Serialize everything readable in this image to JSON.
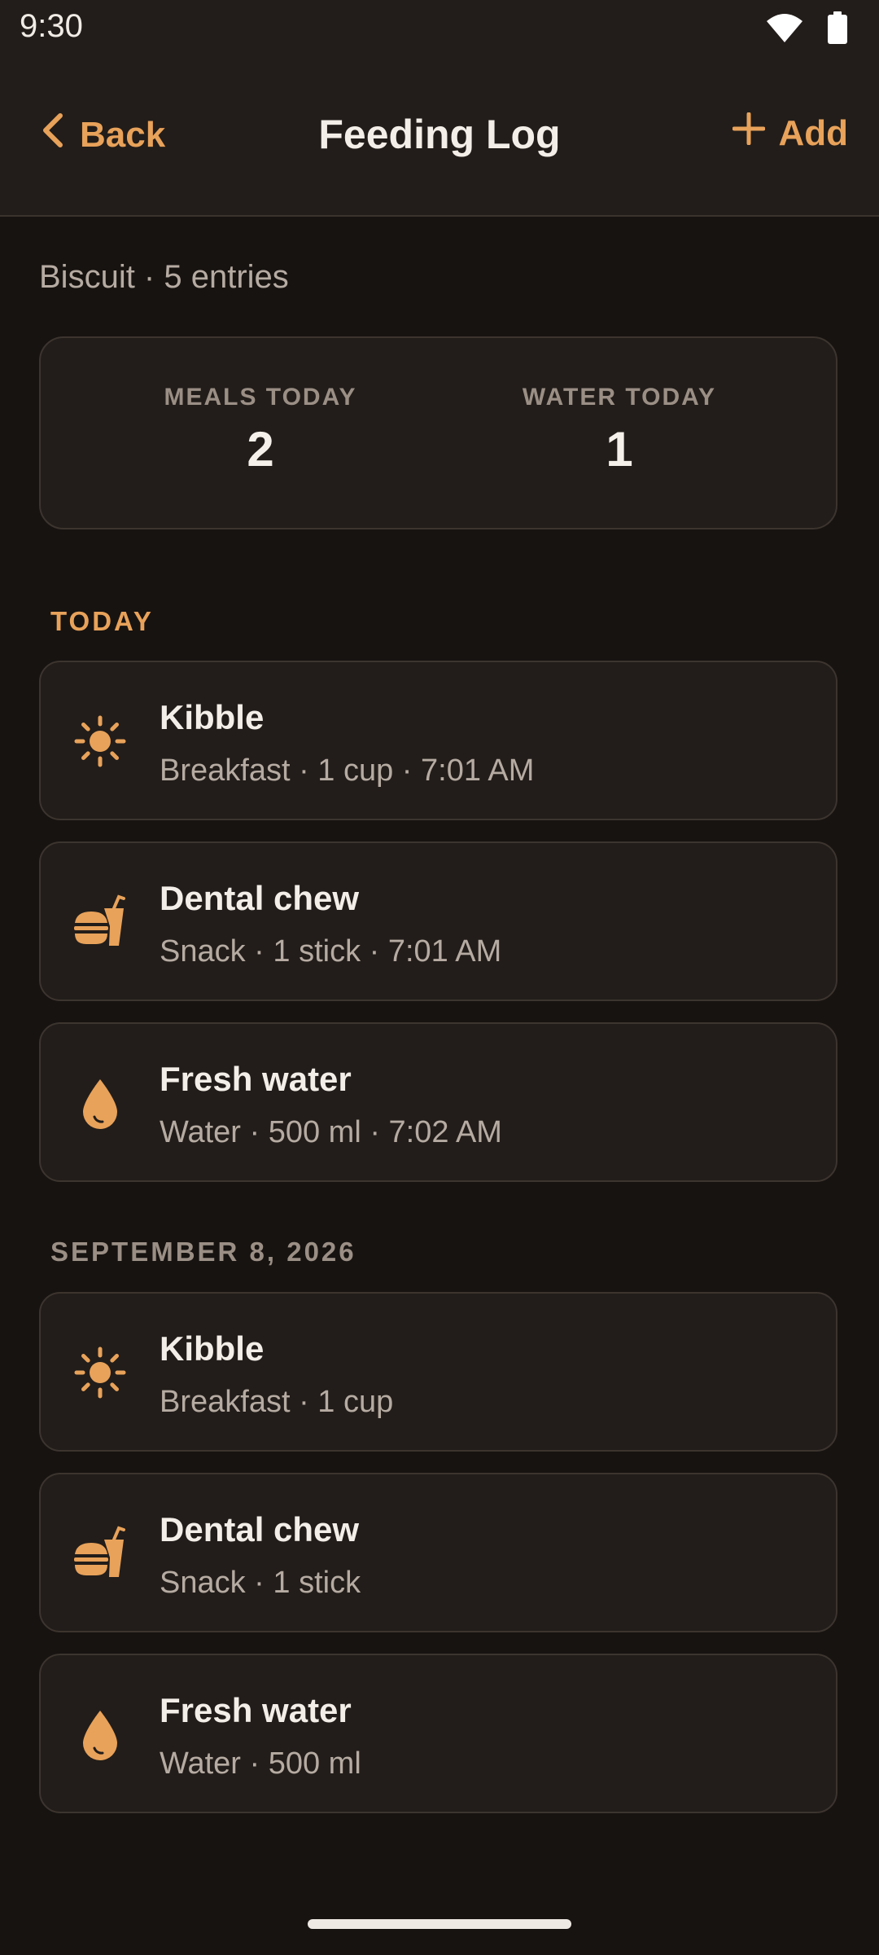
{
  "status_bar": {
    "time": "9:30",
    "wifi_icon": "wifi-icon",
    "battery_icon": "battery-icon"
  },
  "header": {
    "back_label": "Back",
    "title": "Feeding Log",
    "add_label": "Add"
  },
  "subtitle": "Biscuit · 5 entries",
  "stats": {
    "meals_label": "MEALS TODAY",
    "meals_value": "2",
    "water_label": "WATER TODAY",
    "water_value": "1"
  },
  "sections": [
    {
      "label": "TODAY",
      "color": "#e8a25a",
      "entries": [
        {
          "icon": "sun-icon",
          "title": "Kibble",
          "detail": "Breakfast · 1 cup · 7:01 AM"
        },
        {
          "icon": "fastfood-icon",
          "title": "Dental chew",
          "detail": "Snack · 1 stick · 7:01 AM"
        },
        {
          "icon": "water-drop-icon",
          "title": "Fresh water",
          "detail": "Water · 500 ml · 7:02 AM"
        }
      ]
    },
    {
      "label": "SEPTEMBER 8, 2026",
      "color": "#9b8f85",
      "entries": [
        {
          "icon": "sun-icon",
          "title": "Kibble",
          "detail": "Breakfast · 1 cup"
        },
        {
          "icon": "fastfood-icon",
          "title": "Dental chew",
          "detail": "Snack · 1 stick"
        },
        {
          "icon": "water-drop-icon",
          "title": "Fresh water",
          "detail": "Water · 500 ml"
        }
      ]
    }
  ],
  "colors": {
    "accent": "#e8a25a",
    "background": "#171311",
    "card": "#221d1a"
  }
}
